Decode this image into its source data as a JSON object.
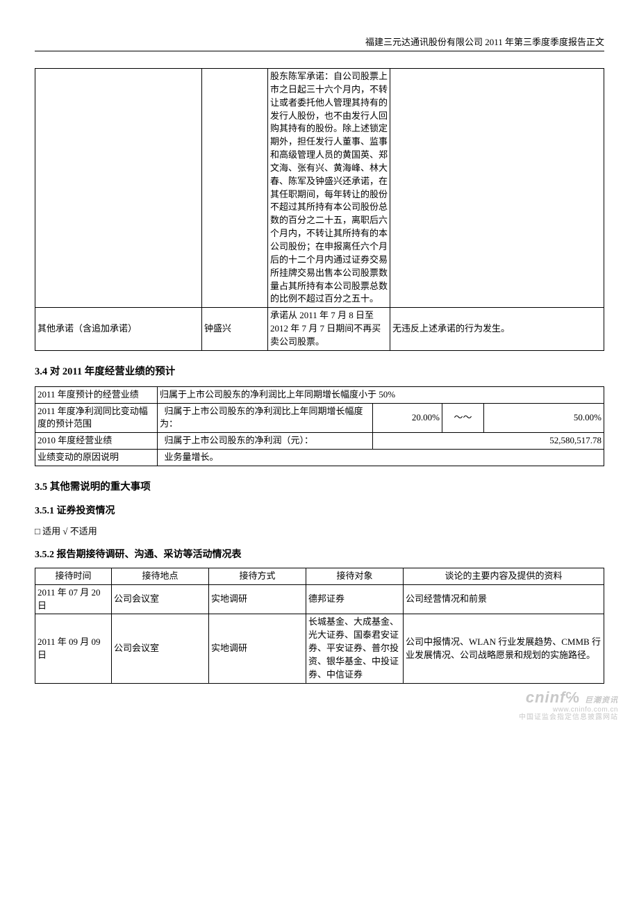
{
  "header": "福建三元达通讯股份有限公司 2011 年第三季度季度报告正文",
  "t1": {
    "r1c1": "",
    "r1c2": "",
    "r1c3": "股东陈军承诺：自公司股票上市之日起三十六个月内，不转让或者委托他人管理其持有的发行人股份，也不由发行人回购其持有的股份。除上述锁定期外，担任发行人董事、监事和高级管理人员的黄国英、郑文海、张有兴、黄海峰、林大春、陈军及钟盛兴还承诺，在其任职期间，每年转让的股份不超过其所持有本公司股份总数的百分之二十五，离职后六个月内，不转让其所持有的本公司股份；在申报离任六个月后的十二个月内通过证券交易所挂牌交易出售本公司股票数量占其所持有本公司股票总数的比例不超过百分之五十。",
    "r1c4": "",
    "r2c1": "其他承诺（含追加承诺）",
    "r2c2": "钟盛兴",
    "r2c3": "承诺从 2011 年 7 月 8 日至 2012 年 7 月 7 日期间不再买卖公司股票。",
    "r2c4": "无违反上述承诺的行为发生。"
  },
  "sec34": "3.4 对 2011 年度经营业绩的预计",
  "t2": {
    "r1a": "2011 年度预计的经营业绩",
    "r1b": "归属于上市公司股东的净利润比上年同期增长幅度小于 50%",
    "r2a": "2011 年度净利润同比变动幅度的预计范围",
    "r2b": "归属于上市公司股东的净利润比上年同期增长幅度为：",
    "r2c": "20.00%",
    "r2d": "～～",
    "r2e": "50.00%",
    "r3a": "2010 年度经营业绩",
    "r3b": "归属于上市公司股东的净利润（元）：",
    "r3c": "52,580,517.78",
    "r4a": "业绩变动的原因说明",
    "r4b": "业务量增长。"
  },
  "sec35": "3.5 其他需说明的重大事项",
  "sec351": "3.5.1 证券投资情况",
  "chk351": "□ 适用 √ 不适用",
  "sec352": "3.5.2 报告期接待调研、沟通、采访等活动情况表",
  "t3": {
    "h1": "接待时间",
    "h2": "接待地点",
    "h3": "接待方式",
    "h4": "接待对象",
    "h5": "谈论的主要内容及提供的资料",
    "r1": {
      "c1": "2011 年 07 月 20 日",
      "c2": "公司会议室",
      "c3": "实地调研",
      "c4": "德邦证券",
      "c5": "公司经营情况和前景"
    },
    "r2": {
      "c1": "2011 年 09 月 09 日",
      "c2": "公司会议室",
      "c3": "实地调研",
      "c4": "长城基金、大成基金、光大证券、国泰君安证券、平安证券、普尔投资、银华基金、中投证券、中信证券",
      "c5": "公司中报情况、WLAN 行业发展趋势、CMMB 行业发展情况、公司战略愿景和规划的实施路径。"
    }
  },
  "wm": {
    "brand": "cninf",
    "zh": "巨潮资讯",
    "url": "www.cninfo.com.cn",
    "cn": "中国证监会指定信息披露网站"
  }
}
